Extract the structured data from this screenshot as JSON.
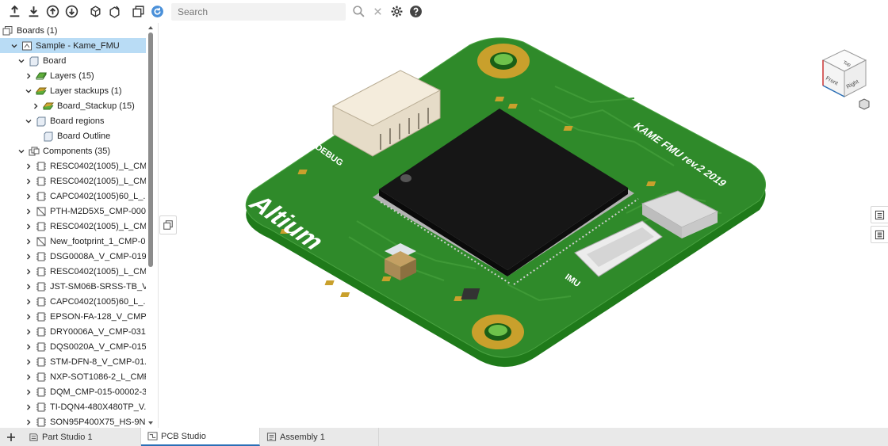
{
  "toolbar": {
    "search_placeholder": "Search"
  },
  "tree": {
    "rows": [
      {
        "label": "Boards (1)",
        "indent": 0,
        "chevron": "none",
        "icon": "boards-icon"
      },
      {
        "label": "Sample - Kame_FMU",
        "indent": 1,
        "chevron": "down",
        "icon": "board-assembly-icon",
        "selected": true
      },
      {
        "label": "Board",
        "indent": 2,
        "chevron": "down",
        "icon": "board-folder-icon"
      },
      {
        "label": "Layers (15)",
        "indent": 3,
        "chevron": "right",
        "icon": "layers-icon"
      },
      {
        "label": "Layer stackups (1)",
        "indent": 3,
        "chevron": "down",
        "icon": "stackups-icon"
      },
      {
        "label": "Board_Stackup (15)",
        "indent": 4,
        "chevron": "right",
        "icon": "stackup-icon"
      },
      {
        "label": "Board regions",
        "indent": 3,
        "chevron": "down",
        "icon": "board-folder-icon"
      },
      {
        "label": "Board Outline",
        "indent": 4,
        "chevron": "none",
        "icon": "board-folder-icon"
      },
      {
        "label": "Components (35)",
        "indent": 2,
        "chevron": "down",
        "icon": "components-icon"
      },
      {
        "label": "RESC0402(1005)_L_CM...",
        "indent": 3,
        "chevron": "right",
        "icon": "component-icon"
      },
      {
        "label": "RESC0402(1005)_L_CM...",
        "indent": 3,
        "chevron": "right",
        "icon": "component-icon"
      },
      {
        "label": "CAPC0402(1005)60_L_...",
        "indent": 3,
        "chevron": "right",
        "icon": "component-icon"
      },
      {
        "label": "PTH-M2D5X5_CMP-000...",
        "indent": 3,
        "chevron": "right",
        "icon": "footprint-icon"
      },
      {
        "label": "RESC0402(1005)_L_CM...",
        "indent": 3,
        "chevron": "right",
        "icon": "component-icon"
      },
      {
        "label": "New_footprint_1_CMP-0...",
        "indent": 3,
        "chevron": "right",
        "icon": "footprint-icon"
      },
      {
        "label": "DSG0008A_V_CMP-019...",
        "indent": 3,
        "chevron": "right",
        "icon": "component-icon"
      },
      {
        "label": "RESC0402(1005)_L_CM...",
        "indent": 3,
        "chevron": "right",
        "icon": "component-icon"
      },
      {
        "label": "JST-SM06B-SRSS-TB_V...",
        "indent": 3,
        "chevron": "right",
        "icon": "component-icon"
      },
      {
        "label": "CAPC0402(1005)60_L_...",
        "indent": 3,
        "chevron": "right",
        "icon": "component-icon"
      },
      {
        "label": "EPSON-FA-128_V_CMP-...",
        "indent": 3,
        "chevron": "right",
        "icon": "component-icon"
      },
      {
        "label": "DRY0006A_V_CMP-031-...",
        "indent": 3,
        "chevron": "right",
        "icon": "component-icon"
      },
      {
        "label": "DQS0020A_V_CMP-015...",
        "indent": 3,
        "chevron": "right",
        "icon": "component-icon"
      },
      {
        "label": "STM-DFN-8_V_CMP-01...",
        "indent": 3,
        "chevron": "right",
        "icon": "component-icon"
      },
      {
        "label": "NXP-SOT1086-2_L_CMP...",
        "indent": 3,
        "chevron": "right",
        "icon": "component-icon"
      },
      {
        "label": "DQM_CMP-015-00002-3...",
        "indent": 3,
        "chevron": "right",
        "icon": "component-icon"
      },
      {
        "label": "TI-DQN4-480X480TP_V...",
        "indent": 3,
        "chevron": "right",
        "icon": "component-icon"
      },
      {
        "label": "SON95P400X75_HS-9N...",
        "indent": 3,
        "chevron": "right",
        "icon": "component-icon"
      }
    ]
  },
  "board": {
    "silkscreen_title": "KAME FMU rev.2 2019",
    "logo_text": "Altium",
    "label_debug": "DEBUG",
    "label_imu": "IMU"
  },
  "navcube": {
    "top": "Top",
    "front": "Front",
    "right": "Right"
  },
  "tabs": [
    {
      "label": "Part Studio 1",
      "icon": "part-studio-icon",
      "active": false
    },
    {
      "label": "PCB Studio",
      "icon": "pcb-studio-icon",
      "active": true
    },
    {
      "label": "Assembly 1",
      "icon": "assembly-icon",
      "active": false
    }
  ],
  "colors": {
    "selected_row": "#b9dcf5",
    "accent": "#2b6fb6",
    "pcb_green": "#2f8a2a",
    "pcb_edge": "#1f6f1c"
  }
}
